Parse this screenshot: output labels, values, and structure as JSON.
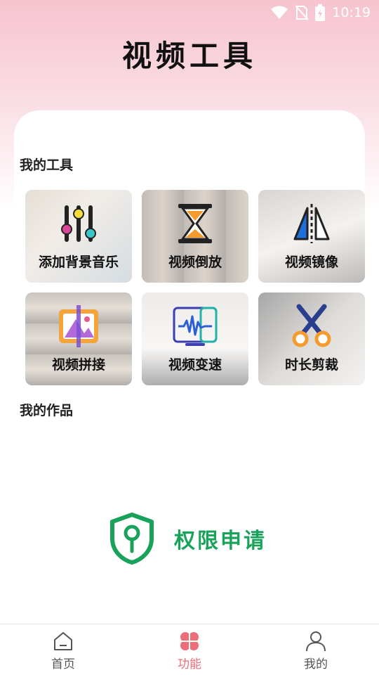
{
  "status_bar": {
    "time": "10:19"
  },
  "header": {
    "title": "视频工具"
  },
  "sections": {
    "tools_title": "我的工具",
    "works_title": "我的作品"
  },
  "tools": [
    {
      "label": "添加背景音乐",
      "icon": "equalizer-icon"
    },
    {
      "label": "视频倒放",
      "icon": "hourglass-icon"
    },
    {
      "label": "视频镜像",
      "icon": "mirror-icon"
    },
    {
      "label": "视频拼接",
      "icon": "splice-icon"
    },
    {
      "label": "视频变速",
      "icon": "waveform-icon"
    },
    {
      "label": "时长剪裁",
      "icon": "scissors-icon"
    }
  ],
  "permission": {
    "label": "权限申请",
    "icon": "shield-icon",
    "color": "#19a35a"
  },
  "bottom_nav": {
    "items": [
      {
        "label": "首页",
        "icon": "home-icon"
      },
      {
        "label": "功能",
        "icon": "clover-icon",
        "active": true
      },
      {
        "label": "我的",
        "icon": "user-icon"
      }
    ],
    "active_color": "#ec6e78"
  }
}
